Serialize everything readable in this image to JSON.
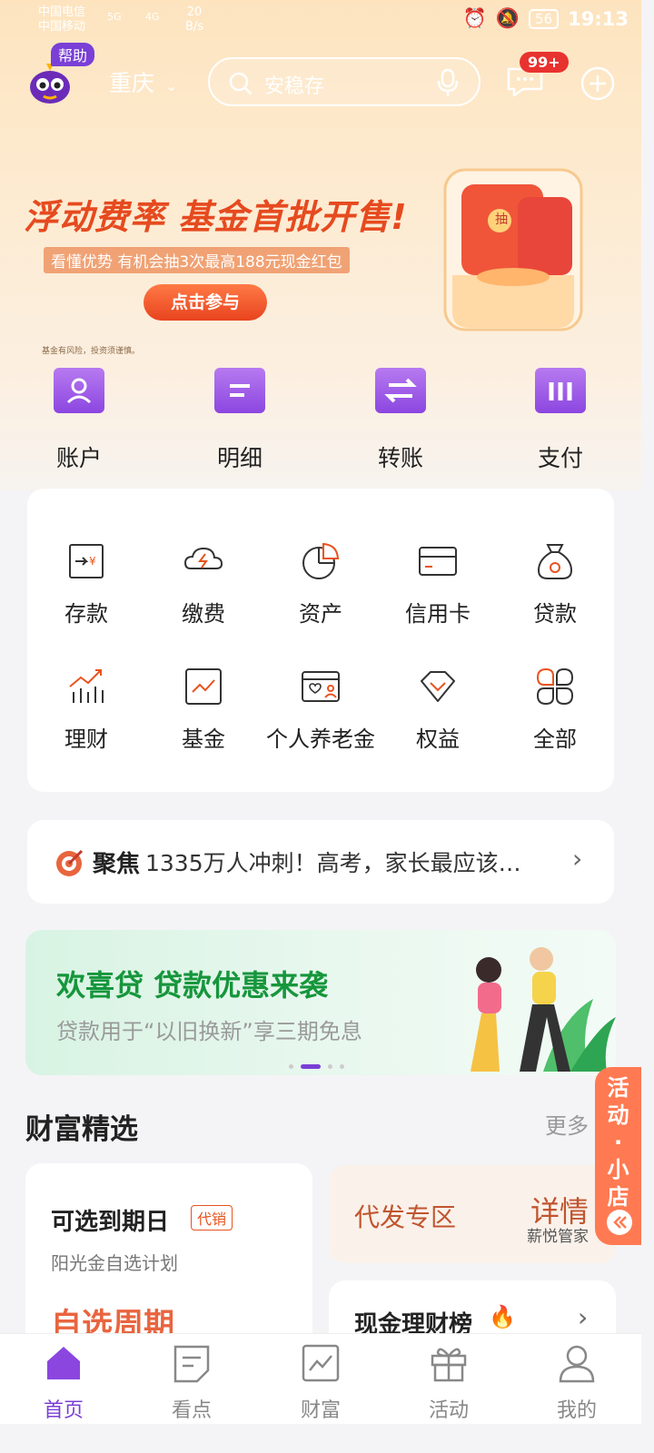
{
  "status_bar": {
    "carrier1": "中国电信",
    "carrier2": "中国移动",
    "net1": "5G",
    "net2": "4G",
    "speed": "20",
    "speed_unit": "B/s",
    "battery": "56",
    "time": "19:13"
  },
  "header": {
    "help_label": "帮助",
    "city": "重庆",
    "search_placeholder": "安稳存",
    "message_badge": "99+"
  },
  "banner": {
    "title": "浮动费率 基金首批开售!",
    "subtitle": "看懂优势 有机会抽3次最高188元现金红包",
    "button": "点击参与",
    "risk_note": "基金有风险，投资须谨慎。",
    "envelope_char": "抽"
  },
  "quick_actions": [
    {
      "label": "账户",
      "icon": "account-icon"
    },
    {
      "label": "明细",
      "icon": "statement-icon"
    },
    {
      "label": "转账",
      "icon": "transfer-icon"
    },
    {
      "label": "支付",
      "icon": "payment-icon"
    }
  ],
  "services": [
    {
      "label": "存款",
      "icon": "deposit-icon"
    },
    {
      "label": "缴费",
      "icon": "bill-pay-icon"
    },
    {
      "label": "资产",
      "icon": "assets-pie-icon"
    },
    {
      "label": "信用卡",
      "icon": "credit-card-icon"
    },
    {
      "label": "贷款",
      "icon": "loan-bag-icon"
    },
    {
      "label": "理财",
      "icon": "wealth-chart-icon"
    },
    {
      "label": "基金",
      "icon": "fund-chart-icon"
    },
    {
      "label": "个人养老金",
      "icon": "pension-card-icon"
    },
    {
      "label": "权益",
      "icon": "benefits-diamond-icon"
    },
    {
      "label": "全部",
      "icon": "all-grid-icon"
    }
  ],
  "news": {
    "tag": "聚焦",
    "text": "1335万人冲刺！高考，家长最应该…"
  },
  "promo": {
    "title": "欢喜贷 贷款优惠来袭",
    "subtitle": "贷款用于“以旧换新”享三期免息",
    "active_dot": 2,
    "dot_count": 4
  },
  "wealth": {
    "title": "财富精选",
    "more": "更多",
    "card1": {
      "title": "可选到期日",
      "tag": "代销",
      "subtitle": "阳光金自选计划",
      "big_text": "自选周期"
    },
    "card2": {
      "title": "代发专区",
      "action": "详情",
      "subtitle": "薪悦管家"
    },
    "card3": {
      "title": "现金理财榜"
    }
  },
  "side_tab": {
    "line1": "活",
    "line2": "动",
    "line3": "·",
    "line4": "小",
    "line5": "店"
  },
  "tabbar": [
    {
      "label": "首页",
      "icon": "home-icon",
      "active": true
    },
    {
      "label": "看点",
      "icon": "news-icon",
      "active": false
    },
    {
      "label": "财富",
      "icon": "wealth-icon",
      "active": false
    },
    {
      "label": "活动",
      "icon": "gift-icon",
      "active": false
    },
    {
      "label": "我的",
      "icon": "profile-icon",
      "active": false
    }
  ],
  "colors": {
    "brand": "#7a3fd6",
    "accent": "#e64a1f",
    "badge": "#e8322f",
    "icon_orange": "#e8531f"
  }
}
